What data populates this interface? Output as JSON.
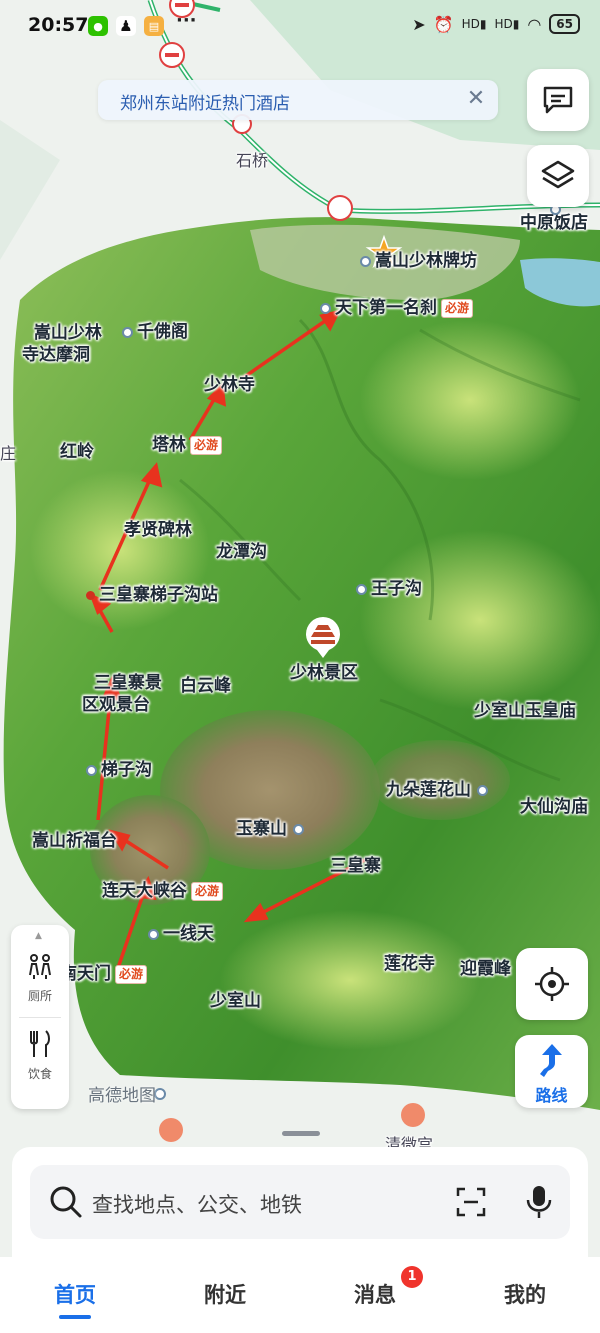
{
  "status_bar": {
    "time": "20:57",
    "network_1": "HD",
    "network_2": "HD",
    "battery": "65"
  },
  "banner": {
    "text": "郑州东站附近热门酒店",
    "close_icon": "close-icon"
  },
  "map": {
    "must_visit_tag": "必游",
    "watermark": "高德地图",
    "scenic_area_name": "少林景区",
    "road_label": "石桥",
    "pois": {
      "zhongyuan_hotel": "中原饭店",
      "paifang": "嵩山少林牌坊",
      "tianxia": "天下第一名刹",
      "damo_cave": "嵩山少林\n寺达摩洞",
      "qianfo": "千佛阁",
      "shaolin_temple": "少林寺",
      "honglin": "红岭",
      "talin": "塔林",
      "edge_zhuang": "庄",
      "xiaoxian": "孝贤碑林",
      "longtan": "龙潭沟",
      "wangzi": "王子沟",
      "sanhuang_station": "三皇寨梯子沟站",
      "sanhuang_viewpoint": "三皇寨景\n区观景台",
      "baiyun": "白云峰",
      "shaoshi_yuhuang": "少室山玉皇庙",
      "tizigou": "梯子沟",
      "jiuduo": "九朵莲花山",
      "daxian": "大仙沟庙",
      "qifutai": "嵩山祈福台",
      "yuzhai": "玉寨山",
      "sanhuangzhai": "三皇寨",
      "liantian": "连天大峡谷",
      "yixiantian": "一线天",
      "nantianmen": "南天门",
      "lianhuasi": "莲花寺",
      "yingxia": "迎霞峰",
      "shaoshishan": "少室山",
      "qingweigong": "清微宫"
    }
  },
  "controls": {
    "message_icon": "message-icon",
    "layers_icon": "layers-icon",
    "locate_icon": "locate-icon",
    "toilet_label": "厕所",
    "dining_label": "饮食",
    "route_label": "路线"
  },
  "search": {
    "placeholder": "查找地点、公交、地铁"
  },
  "tabs": {
    "home": "首页",
    "nearby": "附近",
    "messages": "消息",
    "mine": "我的",
    "messages_badge": "1"
  },
  "colors": {
    "accent": "#1a6fe8",
    "route_arrow": "#e8321e",
    "badge": "#f0342c",
    "must_visit": "#e04a1e"
  }
}
